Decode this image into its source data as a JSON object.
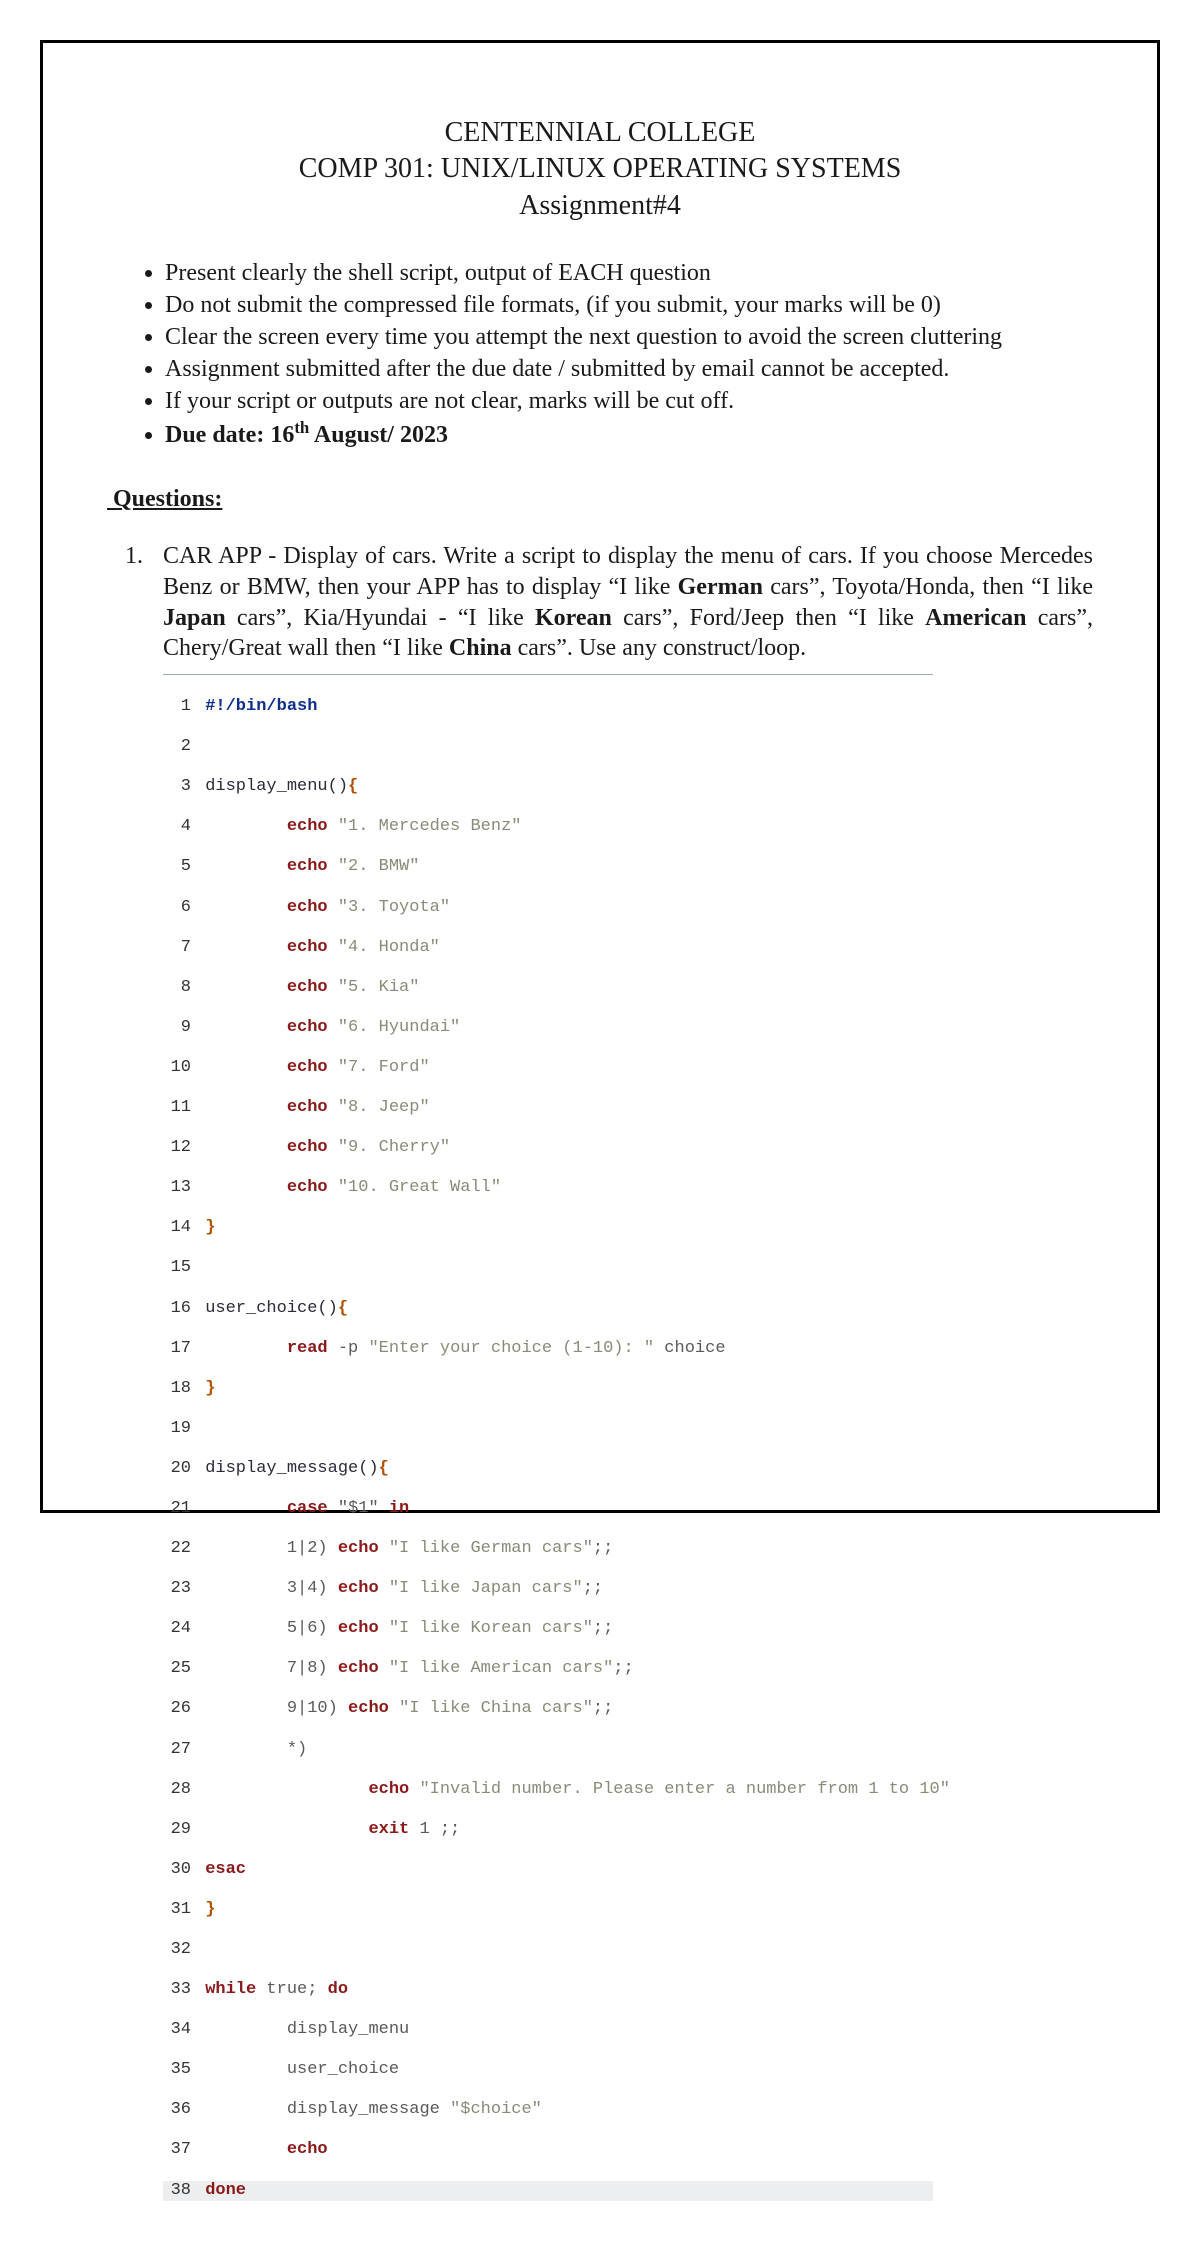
{
  "header": {
    "line1": "CENTENNIAL COLLEGE",
    "line2": "COMP 301: UNIX/LINUX OPERATING SYSTEMS",
    "line3": "Assignment#4"
  },
  "bullets": [
    "Present clearly the shell script, output of EACH question",
    "Do not submit the compressed file formats, (if you submit, your marks will be 0)",
    "Clear the screen every time you attempt the next question to avoid the screen cluttering",
    "Assignment submitted after the due date / submitted by email cannot be accepted.",
    "If your script or outputs are not clear, marks will be cut off."
  ],
  "due_prefix": "Due date: 16",
  "due_sup": "th",
  "due_suffix": " August/ 2023",
  "questions_label": "Questions:",
  "q1": {
    "num": "1.",
    "p1a": "CAR APP - Display of cars. Write a script to display the menu of cars.  If you choose Mercedes Benz or BMW, then your APP has to display “I like ",
    "b1": "German",
    "p1b": " cars”, Toyota/Honda, then “I like ",
    "b2": "Japan",
    "p1c": " cars”, Kia/Hyundai - “I like ",
    "b3": "Korean",
    "p1d": " cars”, Ford/Jeep then “I like ",
    "b4": "American",
    "p1e": " cars”, Chery/Great wall then “I like ",
    "b5": "China",
    "p1f": " cars”.  Use any construct/loop."
  },
  "code": {
    "l1": "#!/bin/bash",
    "l3": "display_menu()",
    "e4": "echo",
    "s4": "\"1. Mercedes Benz\"",
    "e5": "echo",
    "s5": "\"2. BMW\"",
    "e6": "echo",
    "s6": "\"3. Toyota\"",
    "e7": "echo",
    "s7": "\"4. Honda\"",
    "e8": "echo",
    "s8": "\"5. Kia\"",
    "e9": "echo",
    "s9": "\"6. Hyundai\"",
    "e10": "echo",
    "s10": "\"7. Ford\"",
    "e11": "echo",
    "s11": "\"8. Jeep\"",
    "e12": "echo",
    "s12": "\"9. Cherry\"",
    "e13": "echo",
    "s13": "\"10. Great Wall\"",
    "l16": "user_choice()",
    "r17": "read",
    "r17b": " -p ",
    "s17": "\"Enter your choice (1-10): \"",
    "s17v": " choice",
    "l20": "display_message()",
    "c21": "case",
    "c21b": " \"$1\" ",
    "in21": "in",
    "p22": "1|2) ",
    "e22": "echo",
    "s22": "\"I like German cars\"",
    "p23": "3|4) ",
    "e23": "echo",
    "s23": "\"I like Japan cars\"",
    "p24": "5|6) ",
    "e24": "echo",
    "s24": "\"I like Korean cars\"",
    "p25": "7|8) ",
    "e25": "echo",
    "s25": "\"I like American cars\"",
    "p26": "9|10) ",
    "e26": "echo",
    "s26": "\"I like China cars\"",
    "p27": "*)",
    "e28": "echo",
    "s28": "\"Invalid number. Please enter a number from 1 to 10\"",
    "x29": "exit",
    "x29b": " 1 ;;",
    "esac": "esac",
    "w33": "while",
    "w33b": " true; ",
    "do33": "do",
    "l34": "display_menu",
    "l35": "user_choice",
    "l36a": "display_message ",
    "s36": "\"$choice\"",
    "e37": "echo",
    "done": "done",
    "semi": ";;",
    "ob": "{",
    "cb": "}"
  }
}
